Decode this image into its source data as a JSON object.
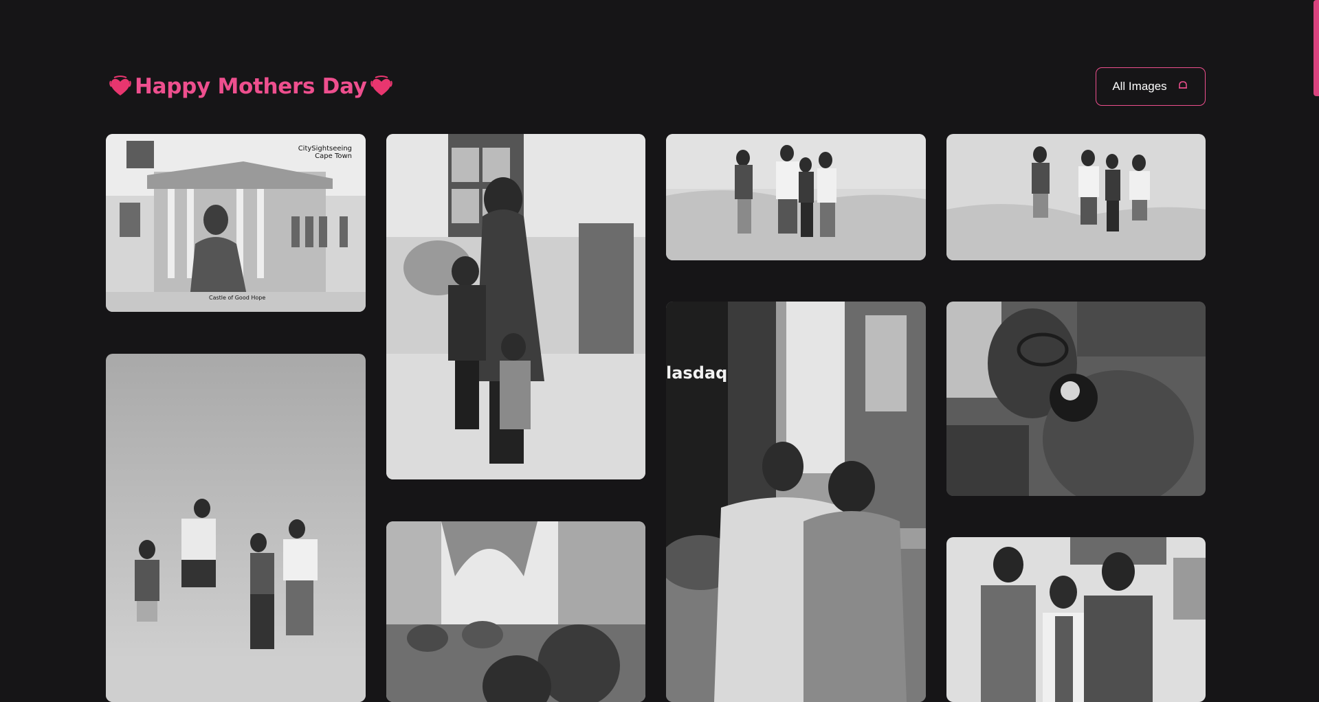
{
  "header": {
    "title": "Happy Mothers Day",
    "left_emoji": "heart-icon",
    "right_emoji": "heart-icon",
    "accent_color": "#ee4f8e"
  },
  "controls": {
    "all_images_label": "All Images",
    "all_images_icon": "bell-icon"
  },
  "colors": {
    "background": "#161517",
    "accent": "#ee4f8e",
    "button_text": "#ffffff"
  },
  "gallery": {
    "photos": [
      {
        "name": "photo-castle-of-good-hope",
        "caption_top": "CitySightseeing Cape Town",
        "caption_bottom": "Castle of Good Hope"
      },
      {
        "name": "photo-family-indoors"
      },
      {
        "name": "photo-desert-group-standing"
      },
      {
        "name": "photo-desert-group-jumping"
      },
      {
        "name": "photo-desert-jump-tall"
      },
      {
        "name": "photo-times-square",
        "sign_text": "lasdaq"
      },
      {
        "name": "photo-selfie-car"
      },
      {
        "name": "photo-palace-selfie"
      },
      {
        "name": "photo-three-indoors"
      }
    ]
  }
}
